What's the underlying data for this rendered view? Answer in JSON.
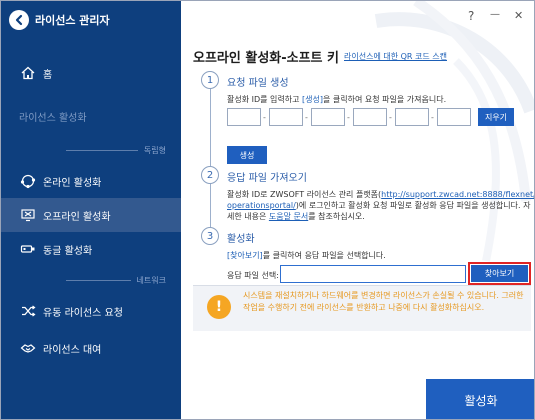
{
  "app": {
    "title": "라이선스 관리자"
  },
  "window_controls": {
    "help": "?",
    "minimize": "—",
    "close": "✕"
  },
  "sidebar": {
    "items": [
      {
        "label": "홈",
        "icon": "home-icon",
        "state": "normal"
      },
      {
        "label": "라이선스 활성화",
        "icon": "",
        "state": "dim"
      },
      {
        "label": "온라인 활성화",
        "icon": "globe-icon",
        "state": "normal"
      },
      {
        "label": "오프라인 활성화",
        "icon": "offline-screen-icon",
        "state": "active"
      },
      {
        "label": "동글 활성화",
        "icon": "dongle-icon",
        "state": "normal"
      },
      {
        "label": "유동 라이선스 요청",
        "icon": "shuffle-icon",
        "state": "normal"
      },
      {
        "label": "라이선스 대여",
        "icon": "handshake-icon",
        "state": "normal"
      }
    ],
    "dividers": {
      "standalone": "독립형",
      "network": "네트워크"
    }
  },
  "main": {
    "title": "오프라인 활성화-소프트 키",
    "title_link": "라이선스에 대한 QR 코드 스캔",
    "steps": [
      {
        "number": "1",
        "title": "요청 파일 생성"
      },
      {
        "number": "2",
        "title": "응답 파일 가져오기"
      },
      {
        "number": "3",
        "title": "활성화"
      }
    ],
    "step1": {
      "desc_before": "활성화 ID를 입력하고 ",
      "desc_highlight": "[생성]",
      "desc_after": "을 클릭하여 요청 파일을 가져옵니다.",
      "clear_label": "지우기",
      "generate_label": "생성"
    },
    "step2": {
      "desc_line1_before": "활성화 ID로 ZWSOFT 라이선스 관리 플랫폼(",
      "desc_url1": "http://support.zwcad.net:8888/flexnet/",
      "desc_url2": "operationsportal/",
      "desc_line2_after": ")에 로그인하고 활성화 요청 파일로 활성화 응답 파일을 생성합니다. 자",
      "desc_line3_before": "세한 내용은 ",
      "desc_doc_link": "도움말 문서",
      "desc_line3_after": "를 참조하십시오."
    },
    "step3": {
      "desc_highlight": "[찾아보기]",
      "desc_after": "를 클릭하여 응답 파일을 선택합니다.",
      "file_label": "응답 파일 선택:",
      "file_value": "",
      "browse_label": "찾아보기"
    },
    "warning": {
      "icon": "!",
      "text": "시스템을 재설치하거나 하드웨어를 변경하면 라이선스가 손실될 수 있습니다. 그러한 작업을 수행하기 전에 라이선스를 반환하고 나중에 다시 활성화하십시오."
    },
    "activate_label": "활성화"
  },
  "colors": {
    "sidebar": "#0e3f7e",
    "sidebar_active": "#33598f",
    "accent": "#1f5fbf",
    "warning": "#f5a623",
    "highlight_border": "#e02424"
  }
}
